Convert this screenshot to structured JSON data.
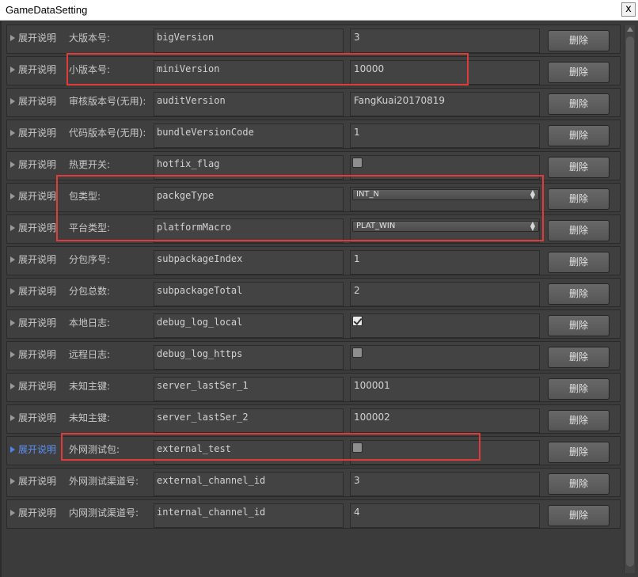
{
  "window": {
    "title": "GameDataSetting",
    "close_glyph": "x"
  },
  "colors": {
    "panel": "#3f3f3f",
    "highlight": "#e03b3b",
    "active_foldout": "#5d8ff0"
  },
  "rows": [
    {
      "foldout": "展开说明",
      "label": "大版本号:",
      "field": "bigVersion",
      "type": "text",
      "value": "3",
      "delete": "删除"
    },
    {
      "foldout": "展开说明",
      "label": "小版本号:",
      "field": "miniVersion",
      "type": "text",
      "value": "10000",
      "delete": "删除"
    },
    {
      "foldout": "展开说明",
      "label": "审核版本号(无用):",
      "field": "auditVersion",
      "type": "text",
      "value": "FangKuai20170819",
      "delete": "删除"
    },
    {
      "foldout": "展开说明",
      "label": "代码版本号(无用):",
      "field": "bundleVersionCode",
      "type": "text",
      "value": "1",
      "delete": "删除"
    },
    {
      "foldout": "展开说明",
      "label": "热更开关:",
      "field": "hotfix_flag",
      "type": "checkbox",
      "checked": false,
      "delete": "删除"
    },
    {
      "foldout": "展开说明",
      "label": "包类型:",
      "field": "packgeType",
      "type": "dropdown",
      "value": "INT_N",
      "delete": "删除"
    },
    {
      "foldout": "展开说明",
      "label": "平台类型:",
      "field": "platformMacro",
      "type": "dropdown",
      "value": "PLAT_WIN",
      "delete": "删除"
    },
    {
      "foldout": "展开说明",
      "label": "分包序号:",
      "field": "subpackageIndex",
      "type": "text",
      "value": "1",
      "delete": "删除"
    },
    {
      "foldout": "展开说明",
      "label": "分包总数:",
      "field": "subpackageTotal",
      "type": "text",
      "value": "2",
      "delete": "删除"
    },
    {
      "foldout": "展开说明",
      "label": "本地日志:",
      "field": "debug_log_local",
      "type": "checkbox",
      "checked": true,
      "delete": "删除"
    },
    {
      "foldout": "展开说明",
      "label": "远程日志:",
      "field": "debug_log_https",
      "type": "checkbox",
      "checked": false,
      "delete": "删除"
    },
    {
      "foldout": "展开说明",
      "label": "未知主键:",
      "field": "server_lastSer_1",
      "type": "text",
      "value": "100001",
      "delete": "删除"
    },
    {
      "foldout": "展开说明",
      "label": "未知主键:",
      "field": "server_lastSer_2",
      "type": "text",
      "value": "100002",
      "delete": "删除"
    },
    {
      "foldout": "展开说明",
      "label": "外网测试包:",
      "field": "external_test",
      "type": "checkbox",
      "checked": false,
      "active": true,
      "delete": "删除"
    },
    {
      "foldout": "展开说明",
      "label": "外网测试渠道号:",
      "field": "external_channel_id",
      "type": "text",
      "value": "3",
      "delete": "删除"
    },
    {
      "foldout": "展开说明",
      "label": "内网测试渠道号:",
      "field": "internal_channel_id",
      "type": "text",
      "value": "4",
      "delete": "删除"
    }
  ]
}
